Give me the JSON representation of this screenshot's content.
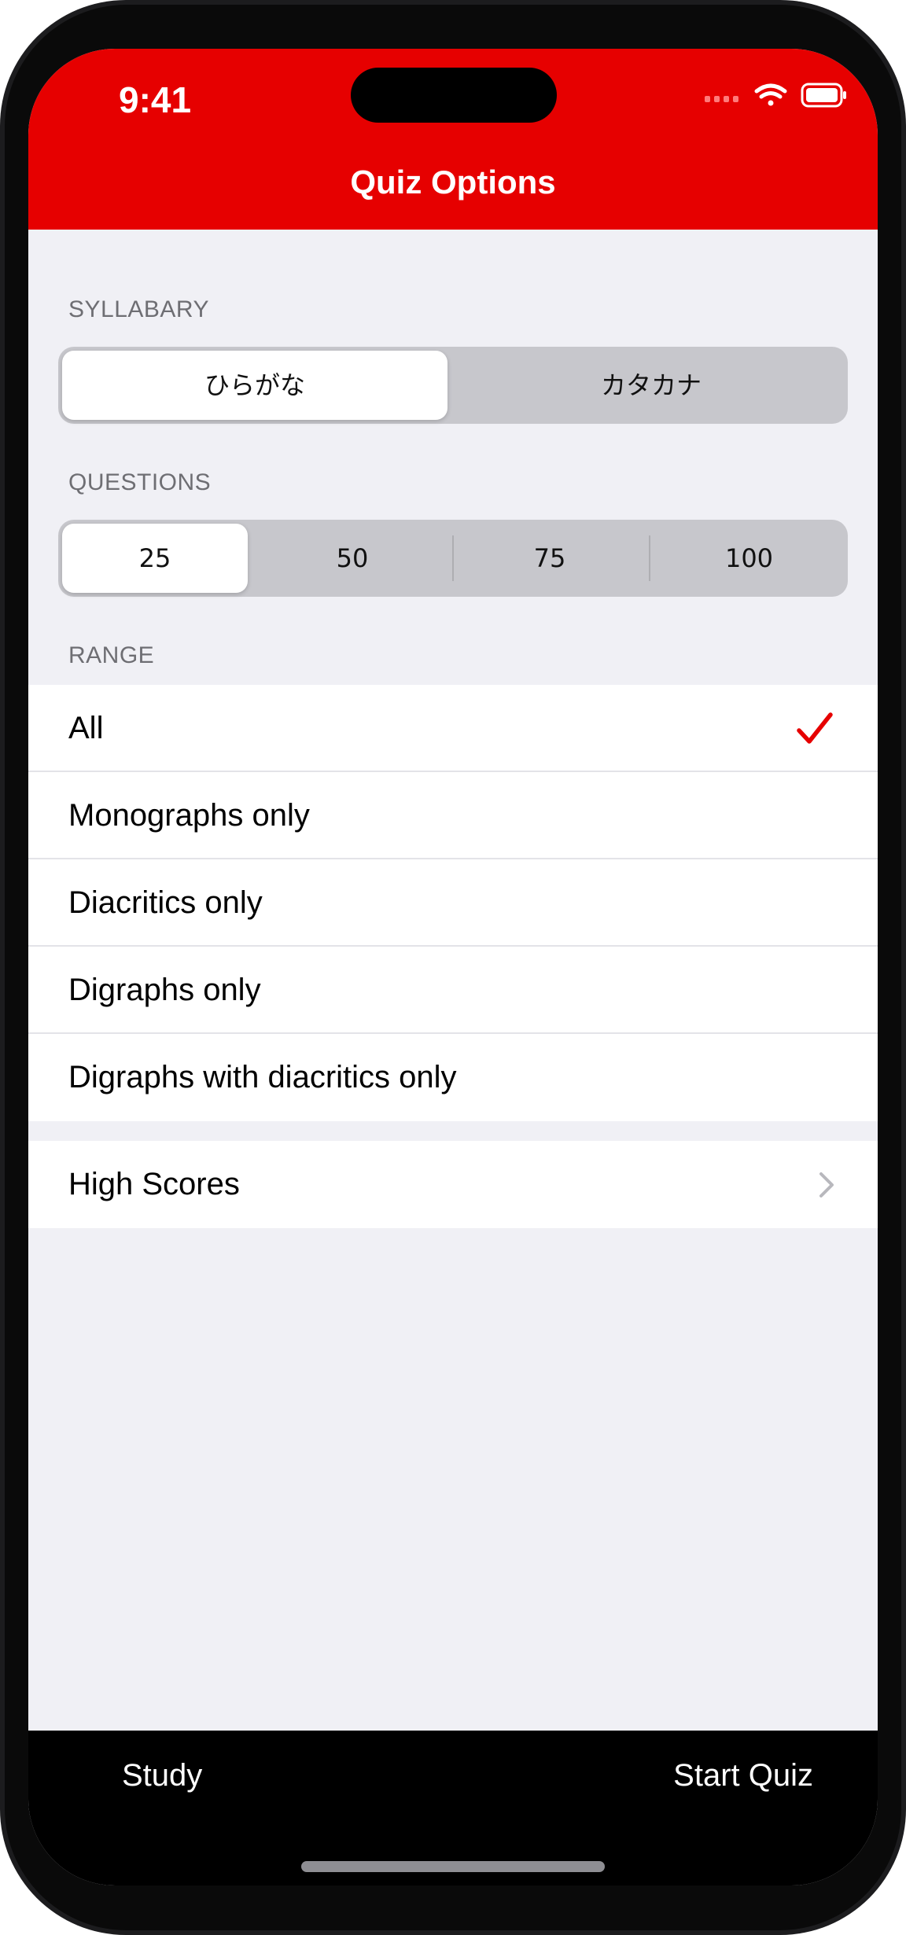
{
  "status_bar": {
    "time": "9:41",
    "icons": [
      "cellular-icon",
      "wifi-icon",
      "battery-icon"
    ]
  },
  "nav": {
    "title": "Quiz Options"
  },
  "syllabary": {
    "label": "SYLLABARY",
    "options": [
      "ひらがな",
      "カタカナ"
    ],
    "selected": "ひらがな"
  },
  "questions": {
    "label": "QUESTIONS",
    "options": [
      "25",
      "50",
      "75",
      "100"
    ],
    "selected": "25"
  },
  "range": {
    "label": "RANGE",
    "items": [
      {
        "label": "All",
        "checked": true
      },
      {
        "label": "Monographs only",
        "checked": false
      },
      {
        "label": "Diacritics only",
        "checked": false
      },
      {
        "label": "Digraphs only",
        "checked": false
      },
      {
        "label": "Digraphs with diacritics only",
        "checked": false
      }
    ]
  },
  "high_scores": {
    "label": "High Scores"
  },
  "toolbar": {
    "study_label": "Study",
    "start_label": "Start Quiz"
  },
  "colors": {
    "accent": "#e60000",
    "background": "#f0f0f5",
    "toolbar": "#000000"
  }
}
